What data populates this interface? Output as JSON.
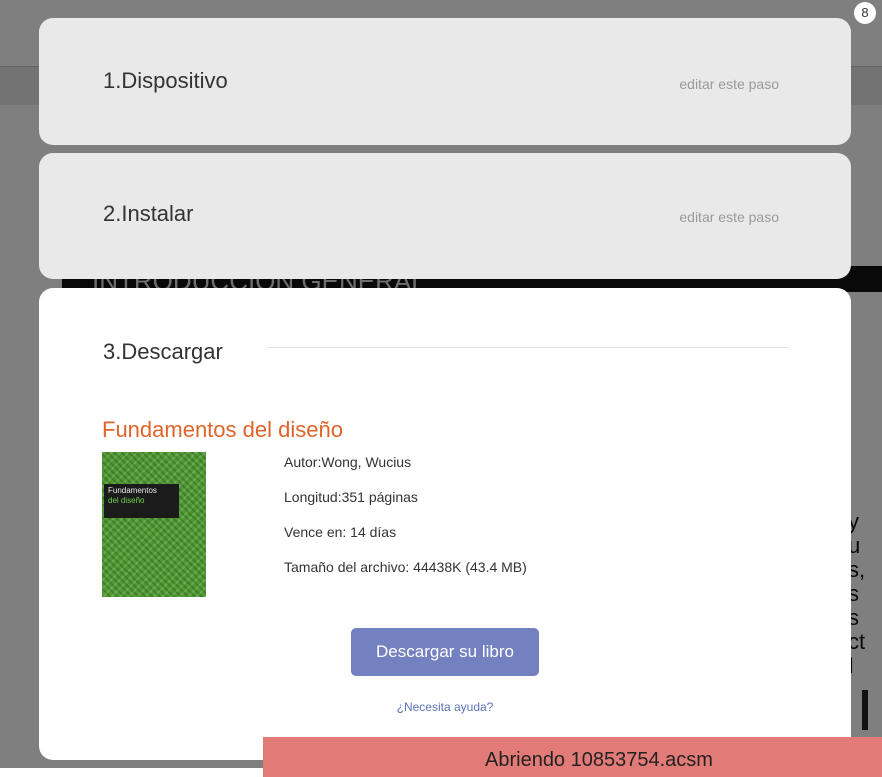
{
  "background": {
    "section_title": "INTRODUCCIÓN GENERAL",
    "toolbar_icons": [
      "download-icon",
      "flip-icon",
      "copy-icon",
      "print-icon",
      "bookmark-add-icon",
      "link-icon"
    ],
    "notification_count": "8",
    "right_edge_chars": [
      "y",
      "u",
      "s,",
      "s",
      "s",
      "ct",
      "I"
    ]
  },
  "steps": [
    {
      "label": "1.Dispositivo",
      "edit_label": "editar este paso"
    },
    {
      "label": "2.Instalar",
      "edit_label": "editar este paso"
    },
    {
      "label": "3.Descargar"
    }
  ],
  "book": {
    "title": "Fundamentos del diseño",
    "cover_line1": "Fundamentos",
    "cover_line2": "del diseño",
    "author": "Autor:Wong, Wucius",
    "length": "Longitud:351 páginas",
    "expires": "Vence en: 14 días",
    "size": "Tamaño del archivo: 44438K (43.4 MB)"
  },
  "download_button_label": "Descargar su libro",
  "help_link": "¿Necesita ayuda?",
  "toast_text": "Abriendo 10853754.acsm",
  "colors": {
    "accent_orange": "#e0642a",
    "button": "#7481c0",
    "toast": "#e27b77",
    "link": "#5a73b8"
  }
}
